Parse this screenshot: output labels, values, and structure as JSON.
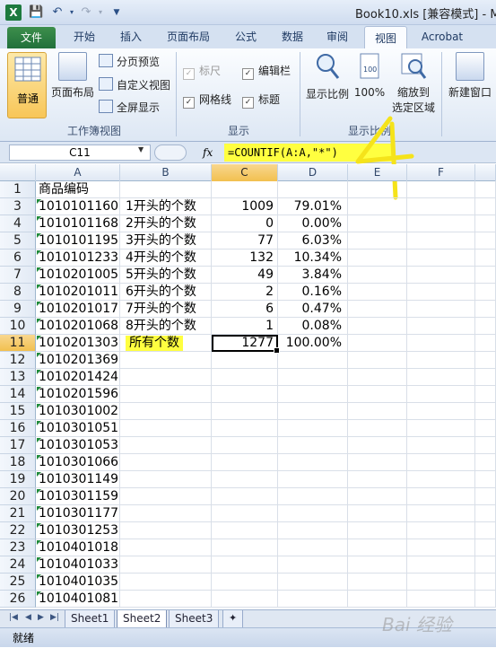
{
  "window": {
    "title": "Book10.xls  [兼容模式] - M",
    "app_icon": "excel-logo"
  },
  "ribbon_tabs": [
    {
      "label": "文件"
    },
    {
      "label": "开始"
    },
    {
      "label": "插入"
    },
    {
      "label": "页面布局"
    },
    {
      "label": "公式"
    },
    {
      "label": "数据"
    },
    {
      "label": "审阅"
    },
    {
      "label": "视图"
    },
    {
      "label": "Acrobat"
    }
  ],
  "ribbon": {
    "workbook_views": {
      "normal": "普通",
      "page_layout": "页面布局",
      "page_break_preview": "分页预览",
      "custom_views": "自定义视图",
      "full_screen": "全屏显示",
      "group_label": "工作簿视图"
    },
    "show": {
      "ruler": "标尺",
      "formula_bar": "编辑栏",
      "gridlines": "网格线",
      "headings": "标题",
      "group_label": "显示"
    },
    "zoom": {
      "zoom": "显示比例",
      "zoom_100": "100%",
      "zoom_selection_1": "缩放到",
      "zoom_selection_2": "选定区域",
      "group_label": "显示比例"
    },
    "window": {
      "new_window": "新建窗口"
    }
  },
  "formula_bar": {
    "name_box": "C11",
    "fx": "fx",
    "formula": "=COUNTIF(A:A,\"*\")"
  },
  "columns": [
    "A",
    "B",
    "C",
    "D",
    "E",
    "F"
  ],
  "rows": [
    {
      "num": "1",
      "a": "商品编码",
      "b": "",
      "c": "",
      "d": ""
    },
    {
      "num": "3",
      "a": "1010101160",
      "b": "1开头的个数",
      "c": "1009",
      "d": "79.01%"
    },
    {
      "num": "4",
      "a": "1010101168",
      "b": "2开头的个数",
      "c": "0",
      "d": "0.00%"
    },
    {
      "num": "5",
      "a": "1010101195",
      "b": "3开头的个数",
      "c": "77",
      "d": "6.03%"
    },
    {
      "num": "6",
      "a": "1010101233",
      "b": "4开头的个数",
      "c": "132",
      "d": "10.34%"
    },
    {
      "num": "7",
      "a": "1010201005",
      "b": "5开头的个数",
      "c": "49",
      "d": "3.84%"
    },
    {
      "num": "8",
      "a": "1010201011",
      "b": "6开头的个数",
      "c": "2",
      "d": "0.16%"
    },
    {
      "num": "9",
      "a": "1010201017",
      "b": "7开头的个数",
      "c": "6",
      "d": "0.47%"
    },
    {
      "num": "10",
      "a": "1010201068",
      "b": "8开头的个数",
      "c": "1",
      "d": "0.08%"
    },
    {
      "num": "11",
      "a": "1010201303",
      "b": "所有个数",
      "c": "1277",
      "d": "100.00%"
    },
    {
      "num": "12",
      "a": "1010201369",
      "b": "",
      "c": "",
      "d": ""
    },
    {
      "num": "13",
      "a": "1010201424",
      "b": "",
      "c": "",
      "d": ""
    },
    {
      "num": "14",
      "a": "1010201596",
      "b": "",
      "c": "",
      "d": ""
    },
    {
      "num": "15",
      "a": "1010301002",
      "b": "",
      "c": "",
      "d": ""
    },
    {
      "num": "16",
      "a": "1010301051",
      "b": "",
      "c": "",
      "d": ""
    },
    {
      "num": "17",
      "a": "1010301053",
      "b": "",
      "c": "",
      "d": ""
    },
    {
      "num": "18",
      "a": "1010301066",
      "b": "",
      "c": "",
      "d": ""
    },
    {
      "num": "19",
      "a": "1010301149",
      "b": "",
      "c": "",
      "d": ""
    },
    {
      "num": "20",
      "a": "1010301159",
      "b": "",
      "c": "",
      "d": ""
    },
    {
      "num": "21",
      "a": "1010301177",
      "b": "",
      "c": "",
      "d": ""
    },
    {
      "num": "22",
      "a": "1010301253",
      "b": "",
      "c": "",
      "d": ""
    },
    {
      "num": "23",
      "a": "1010401018",
      "b": "",
      "c": "",
      "d": ""
    },
    {
      "num": "24",
      "a": "1010401033",
      "b": "",
      "c": "",
      "d": ""
    },
    {
      "num": "25",
      "a": "1010401035",
      "b": "",
      "c": "",
      "d": ""
    },
    {
      "num": "26",
      "a": "1010401081",
      "b": "",
      "c": "",
      "d": ""
    }
  ],
  "active_cell": "C11",
  "sheet_tabs": [
    "Sheet1",
    "Sheet2",
    "Sheet3"
  ],
  "active_sheet": "Sheet2",
  "status": {
    "ready": "就绪"
  },
  "watermark": "Bai 经验",
  "colors": {
    "highlight": "#ffff40",
    "file_tab": "#21703a",
    "scribble": "#f5e31a"
  }
}
